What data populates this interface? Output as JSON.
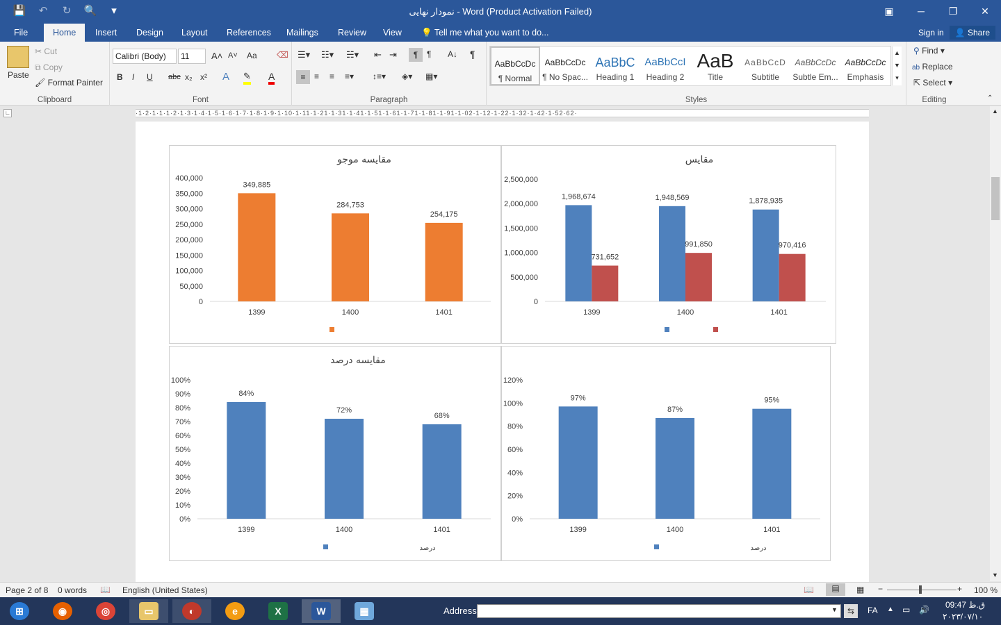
{
  "window": {
    "title": "نمودار نهایی - Word (Product Activation Failed)",
    "min": "─",
    "max": "❐",
    "close": "✕",
    "ribbon_opt": "▣"
  },
  "qat": {
    "save": "💾",
    "undo": "↶",
    "redo": "↻",
    "preview": "🔍",
    "more": "▾"
  },
  "tabs": [
    {
      "label": "File"
    },
    {
      "label": "Home"
    },
    {
      "label": "Insert"
    },
    {
      "label": "Design"
    },
    {
      "label": "Layout"
    },
    {
      "label": "References"
    },
    {
      "label": "Mailings"
    },
    {
      "label": "Review"
    },
    {
      "label": "View"
    }
  ],
  "tellme": "Tell me what you want to do...",
  "signin": "Sign in",
  "share": "Share",
  "clipboard": {
    "paste": "Paste",
    "cut": "Cut",
    "copy": "Copy",
    "format_painter": "Format Painter",
    "label": "Clipboard"
  },
  "font": {
    "family": "Calibri (Body)",
    "size": "11",
    "label": "Font",
    "case": "Aa",
    "bold": "B",
    "italic": "I",
    "underline": "U",
    "strike": "abc",
    "sub": "x₂",
    "sup": "x²"
  },
  "paragraph": {
    "label": "Paragraph",
    "pilcrow": "¶"
  },
  "styles": {
    "label": "Styles",
    "items": [
      {
        "preview": "AaBbCcDc",
        "name": "¶ Normal"
      },
      {
        "preview": "AaBbCcDc",
        "name": "¶ No Spac..."
      },
      {
        "preview": "AaBbC",
        "name": "Heading 1"
      },
      {
        "preview": "AaBbCcI",
        "name": "Heading 2"
      },
      {
        "preview": "AaB",
        "name": "Title"
      },
      {
        "preview": "AaBbCcD",
        "name": "Subtitle"
      },
      {
        "preview": "AaBbCcDc",
        "name": "Subtle Em..."
      },
      {
        "preview": "AaBbCcDc",
        "name": "Emphasis"
      }
    ]
  },
  "editing": {
    "find": "Find",
    "replace": "Replace",
    "select": "Select",
    "label": "Editing"
  },
  "ruler_text": "·1·2·1·1·1·2·1·3·1·4·1·5·1·6·1·7·1·8·1·9·1·10·1·11·1·21·1·31·1·41·1·51·1·61·1·71·1·81·1·91·1·02·1·12·1·22·1·32·1·42·1·52·62·",
  "charts": [
    {
      "title": "مقایسه موجو",
      "chart_data": {
        "type": "bar",
        "categories": [
          "1399",
          "1400",
          "1401"
        ],
        "series": [
          {
            "values": [
              349885,
              284753,
              254175
            ],
            "color": "#ed7d31"
          }
        ],
        "value_labels": [
          "349,885",
          "284,753",
          "254,175"
        ],
        "ylim": [
          0,
          400000
        ],
        "yticks": [
          "0",
          "50,000",
          "100,000",
          "150,000",
          "200,000",
          "250,000",
          "300,000",
          "350,000",
          "400,000"
        ],
        "legend": "bottom"
      }
    },
    {
      "title": "مقایس",
      "chart_data": {
        "type": "bar",
        "categories": [
          "1399",
          "1400",
          "1401"
        ],
        "series": [
          {
            "values": [
              1968674,
              1948569,
              1878935
            ],
            "color": "#4f81bd"
          },
          {
            "values": [
              731652,
              991850,
              970416
            ],
            "color": "#c0504d"
          }
        ],
        "value_labels": [
          [
            "1,968,674",
            "1,948,569",
            "1,878,935"
          ],
          [
            "731,652",
            "991,850",
            "970,416"
          ]
        ],
        "ylim": [
          0,
          2500000
        ],
        "yticks": [
          "0",
          "500,000",
          "1,000,000",
          "1,500,000",
          "2,000,000",
          "2,500,000"
        ],
        "legend": "bottom"
      }
    },
    {
      "title": "مقایسه درصد",
      "chart_data": {
        "type": "bar",
        "categories": [
          "1399",
          "1400",
          "1401"
        ],
        "series": [
          {
            "values": [
              84,
              72,
              68
            ],
            "color": "#4f81bd"
          }
        ],
        "value_labels": [
          "84%",
          "72%",
          "68%"
        ],
        "ylim": [
          0,
          100
        ],
        "yticks": [
          "0%",
          "10%",
          "20%",
          "30%",
          "40%",
          "50%",
          "60%",
          "70%",
          "80%",
          "90%",
          "100%"
        ],
        "legend": "bottom",
        "legend_text": "درصد"
      }
    },
    {
      "title": "",
      "chart_data": {
        "type": "bar",
        "categories": [
          "1399",
          "1400",
          "1401"
        ],
        "series": [
          {
            "values": [
              97,
              87,
              95
            ],
            "color": "#4f81bd"
          }
        ],
        "value_labels": [
          "97%",
          "87%",
          "95%"
        ],
        "ylim": [
          0,
          120
        ],
        "yticks": [
          "0%",
          "20%",
          "40%",
          "60%",
          "80%",
          "100%",
          "120%"
        ],
        "legend": "bottom",
        "legend_text": "درصد"
      }
    }
  ],
  "status": {
    "page": "Page 2 of 8",
    "words": "0 words",
    "lang": "English (United States)",
    "zoom": "100 %"
  },
  "taskbar": {
    "address": "Address",
    "lang": "FA",
    "time": "09:47 ق.ظ",
    "date": "۲۰۲۳/۰۷/۱۰"
  }
}
